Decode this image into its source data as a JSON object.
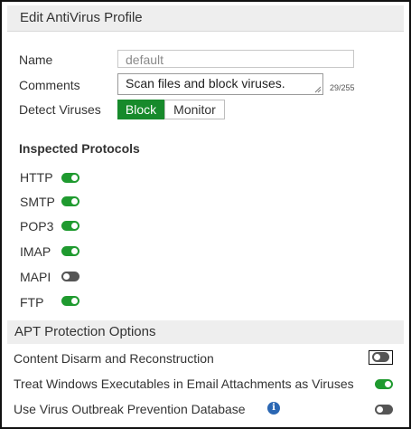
{
  "dialog": {
    "title": "Edit AntiVirus Profile"
  },
  "form": {
    "name_label": "Name",
    "name_placeholder": "default",
    "comments_label": "Comments",
    "comments_value": "Scan files and block viruses.",
    "comments_counter": "29/255",
    "detect_label": "Detect Viruses",
    "detect_options": [
      "Block",
      "Monitor"
    ],
    "detect_selected": "Block"
  },
  "protocols": {
    "title": "Inspected Protocols",
    "items": [
      {
        "label": "HTTP",
        "enabled": true
      },
      {
        "label": "SMTP",
        "enabled": true
      },
      {
        "label": "POP3",
        "enabled": true
      },
      {
        "label": "IMAP",
        "enabled": true
      },
      {
        "label": "MAPI",
        "enabled": false
      },
      {
        "label": "FTP",
        "enabled": true
      }
    ]
  },
  "apt": {
    "title": "APT Protection Options",
    "options": [
      {
        "label": "Content Disarm and Reconstruction",
        "enabled": false
      },
      {
        "label": "Treat Windows Executables in Email Attachments as Viruses",
        "enabled": true
      },
      {
        "label": "Use Virus Outbreak Prevention Database",
        "enabled": false,
        "icon": "info-icon"
      }
    ]
  },
  "colors": {
    "accent_green": "#178a2b",
    "toggle_on": "#1f9a2f",
    "toggle_off": "#555555",
    "info_blue": "#2b67b3",
    "header_bg": "#eeeeee"
  }
}
